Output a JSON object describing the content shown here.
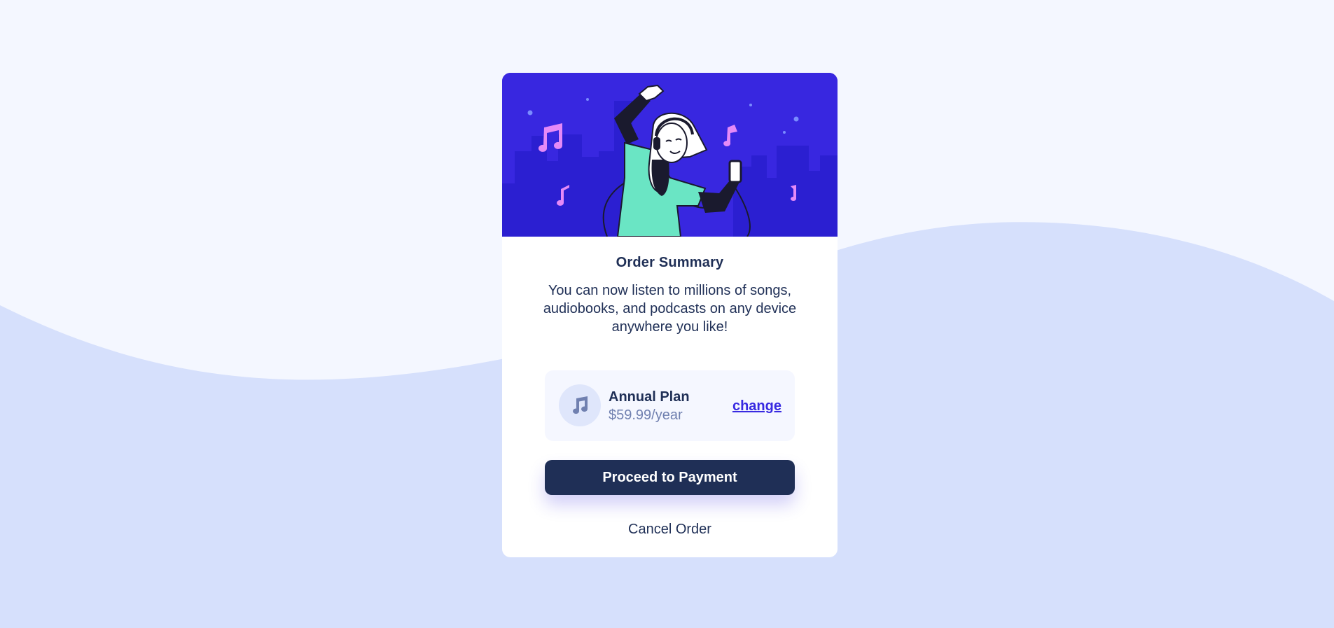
{
  "colors": {
    "page_background": "#f4f7ff",
    "wave": "#d6e0fc",
    "hero_background": "#3827e0",
    "primary_dark": "#1f2f56",
    "accent": "#382ae1",
    "muted_text": "#7080b0",
    "plan_background": "#f5f7ff"
  },
  "hero": {
    "illustration": "person-dancing-with-headphones-illustration"
  },
  "summary": {
    "title": "Order Summary",
    "description": "You can now listen to millions of songs, audiobooks, and podcasts on any device anywhere you like!"
  },
  "plan": {
    "icon": "music-note-icon",
    "name": "Annual Plan",
    "price": "$59.99/year",
    "change_label": "change"
  },
  "actions": {
    "proceed_label": "Proceed to Payment",
    "cancel_label": "Cancel Order"
  }
}
